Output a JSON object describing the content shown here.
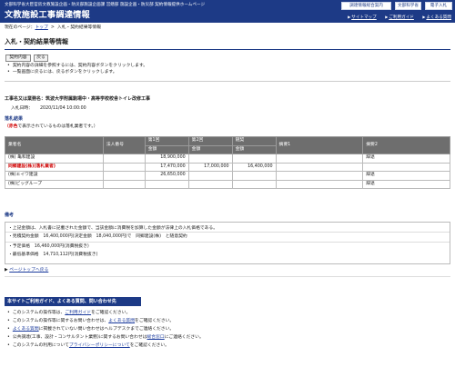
{
  "header": {
    "org": "文部科学省大臣官房文教施設企画・防災部施設企画課 営繕部 施設企画・防災部 契約情報提供ホームページ",
    "site_title": "文教施設工事調達情報",
    "buttons": [
      "調達情報総合案内",
      "文部科学省",
      "電子入札"
    ],
    "nav": [
      "サイトマップ",
      "ご利用ガイド",
      "よくある質問"
    ]
  },
  "breadcrumb": {
    "prefix": "現在のページ：",
    "items": [
      "トップ",
      "入札・契約結果等情報"
    ]
  },
  "page_title": "入札・契約結果等情報",
  "buttons": {
    "detail": "契約内容",
    "back": "戻る"
  },
  "notes": [
    "契約内容の詳細を参照するには、契約内容ボタンをクリックします。",
    "一覧画面に戻るには、戻るボタンをクリックします。"
  ],
  "item": {
    "name": "工事名又は業務名：筑波大学附属駒場中・高等学校校舎トイレ改修工事",
    "open_date_label": "入札日時：",
    "open_date_value": "2020/11/04 10:00:00"
  },
  "result": {
    "heading": "落札結果",
    "note_red": "（赤色",
    "note_rest": "で表示されているものは落札業者です。）",
    "headers": [
      "業者名",
      "法人番号",
      "第1回",
      "第2回",
      "随契",
      "摘要1",
      "摘要2"
    ],
    "subheaders": [
      "金額",
      "金額",
      "金額"
    ],
    "rows": [
      {
        "name": "(株) 亀和建設",
        "corp": "",
        "r1": "18,900,000",
        "r2": "",
        "zuikei": "",
        "m1": "",
        "m2": "辞退",
        "winner": false
      },
      {
        "name": "同郷建設(株)(落札業者)",
        "corp": "",
        "r1": "17,470,000",
        "r2": "17,000,000",
        "zuikei": "16,400,000",
        "m1": "",
        "m2": "",
        "winner": true
      },
      {
        "name": "(株)エイワ建設",
        "corp": "",
        "r1": "26,650,000",
        "r2": "",
        "zuikei": "",
        "m1": "",
        "m2": "辞退",
        "winner": false
      },
      {
        "name": "(株)ビッグループ",
        "corp": "",
        "r1": "",
        "r2": "",
        "zuikei": "",
        "m1": "",
        "m2": "辞退",
        "winner": false
      }
    ]
  },
  "remarks": {
    "heading": "備考",
    "lines": [
      "・上記金額は、入札書に記載された金額で、当該金額に消費税を加算した金額が法律上の入札価格である。",
      "・見積契約金額　16,400,000円(決定金額　18,040,000円)で　同郷建設(株)　と随意契約",
      "・予定価格　16,460,000円(消費税抜き)",
      "・最低基準価格　14,710,112円(消費税抜き)"
    ]
  },
  "page_top": "ページトップへ戻る",
  "help": {
    "heading": "本サイトご利用ガイド、よくある質問、問い合わせ先",
    "items": [
      {
        "pre": "このシステムの操作等は、",
        "link": "ご利用ガイド",
        "post": "をご確認ください。"
      },
      {
        "pre": "このシステムの操作等に関するお問い合わせは、",
        "link": "よくある質問",
        "post": "をご確認ください。"
      },
      {
        "pre": "",
        "link": "よくある質問",
        "post": "に掲載されていない問い合わせはヘルプデスクまでご連絡ください。"
      },
      {
        "pre": "公共調達(工事、設計・コンサルタント業務)に関するお問い合わせは",
        "link": "総合窓口",
        "post": "にご連絡ください。"
      },
      {
        "pre": "このシステムの利用について",
        "link": "プライバシーポリシーについて",
        "post": "をご確認ください。"
      }
    ]
  },
  "colors": {
    "brand": "#1d3a86",
    "winner": "#d00000",
    "table_header": "#6e6e6e"
  }
}
